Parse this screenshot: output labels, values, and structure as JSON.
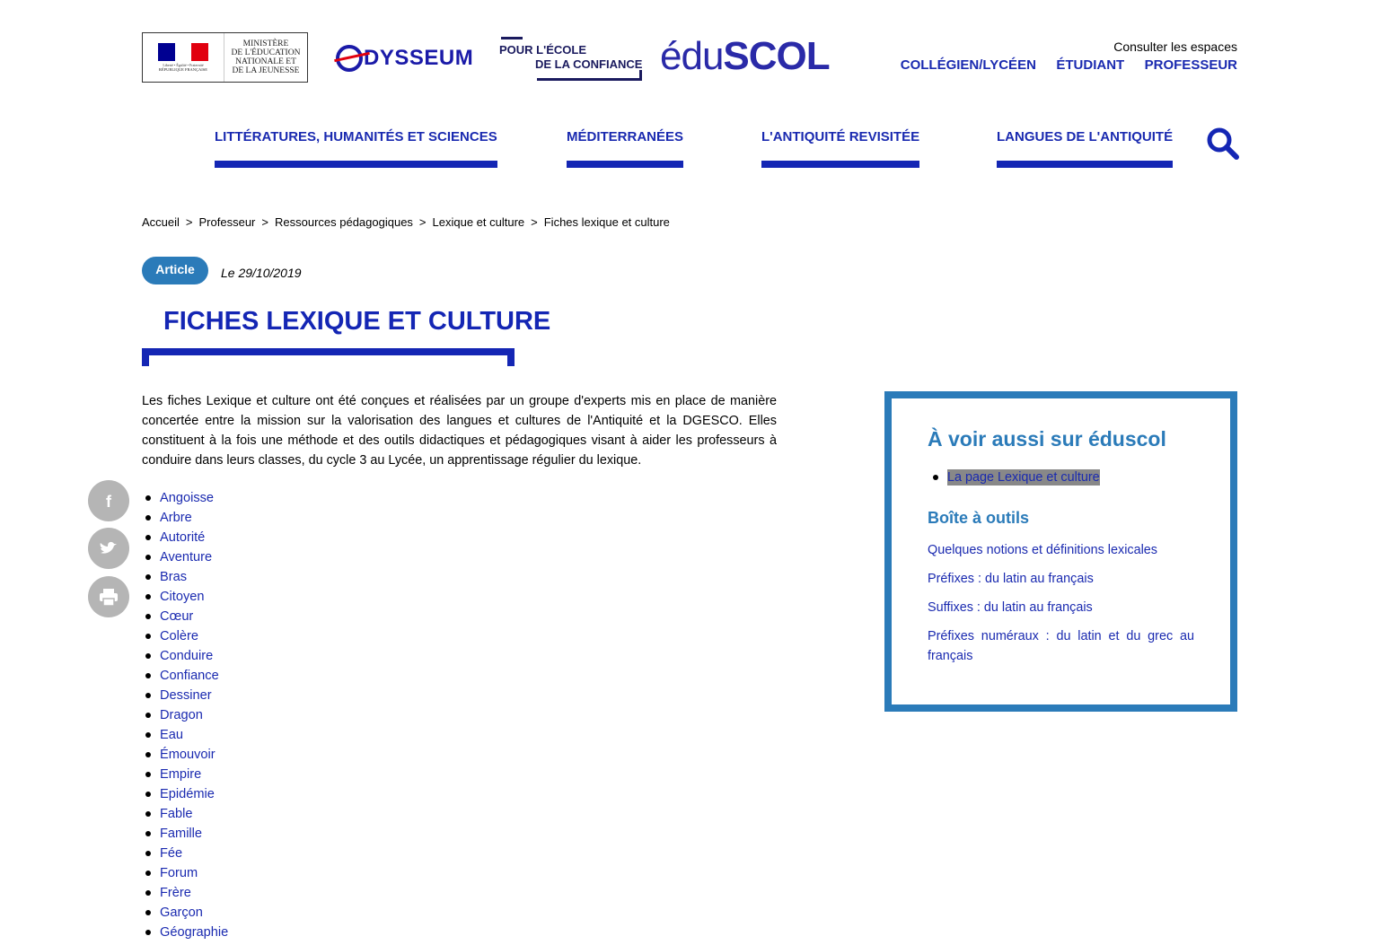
{
  "header": {
    "ministry": {
      "lines": [
        "MINISTÈRE",
        "DE L'ÉDUCATION",
        "NATIONALE ET",
        "DE LA JEUNESSE"
      ],
      "motto": "Liberté • Égalité • Fraternité",
      "republic": "RÉPUBLIQUE FRANÇAISE",
      "flag_colors": [
        "#000091",
        "#ffffff",
        "#e1000f"
      ]
    },
    "odysseum": "DYSSEUM",
    "confiance_line1": "POUR L'ÉCOLE",
    "confiance_line2": "DE LA CONFIANCE",
    "eduscol_light": "édu",
    "eduscol_bold": "SCOL",
    "espaces_label": "Consulter les espaces",
    "espaces": [
      "COLLÉGIEN/LYCÉEN",
      "ÉTUDIANT",
      "PROFESSEUR"
    ]
  },
  "nav": [
    "LITTÉRATURES, HUMANITÉS ET SCIENCES",
    "MÉDITERRANÉES",
    "L'ANTIQUITÉ REVISITÉE",
    "LANGUES DE L'ANTIQUITÉ"
  ],
  "breadcrumb": [
    "Accueil",
    "Professeur",
    "Ressources pédagogiques",
    "Lexique et culture",
    "Fiches lexique et culture"
  ],
  "breadcrumb_sep": ">",
  "article": {
    "badge": "Article",
    "date": "Le 29/10/2019",
    "title": "FICHES LEXIQUE ET CULTURE",
    "intro": "Les fiches Lexique et culture ont été conçues et réalisées par un groupe d'experts mis en place de manière concertée entre la mission sur la valorisation des langues et cultures de l'Antiquité et la DGESCO. Elles constituent à la fois une méthode et des outils didactiques et pédagogiques visant à aider les professeurs à conduire dans leurs classes, du cycle 3 au Lycée, un apprentissage régulier du lexique.",
    "fiches": [
      "Angoisse",
      "Arbre",
      "Autorité",
      "Aventure",
      "Bras",
      "Citoyen",
      "Cœur",
      "Colère",
      "Conduire",
      "Confiance",
      "Dessiner",
      "Dragon",
      "Eau",
      "Émouvoir",
      "Empire",
      "Epidémie",
      "Fable",
      "Famille",
      "Fée",
      "Forum",
      "Frère",
      "Garçon",
      "Géographie"
    ]
  },
  "share_icons": [
    "facebook-icon",
    "twitter-icon",
    "print-icon"
  ],
  "sidebar": {
    "title": "À voir aussi sur éduscol",
    "links": [
      "La page Lexique et culture"
    ],
    "tools_title": "Boîte à outils",
    "tools": [
      "Quelques notions et définitions lexicales",
      "Préfixes : du latin au français",
      "Suffixes : du latin au français",
      "Préfixes numéraux : du latin et du grec au français"
    ]
  },
  "colors": {
    "primary": "#1426b4",
    "accent": "#2b7bb9",
    "link": "#1a2ab0",
    "share_bg": "#b5b5b5"
  }
}
